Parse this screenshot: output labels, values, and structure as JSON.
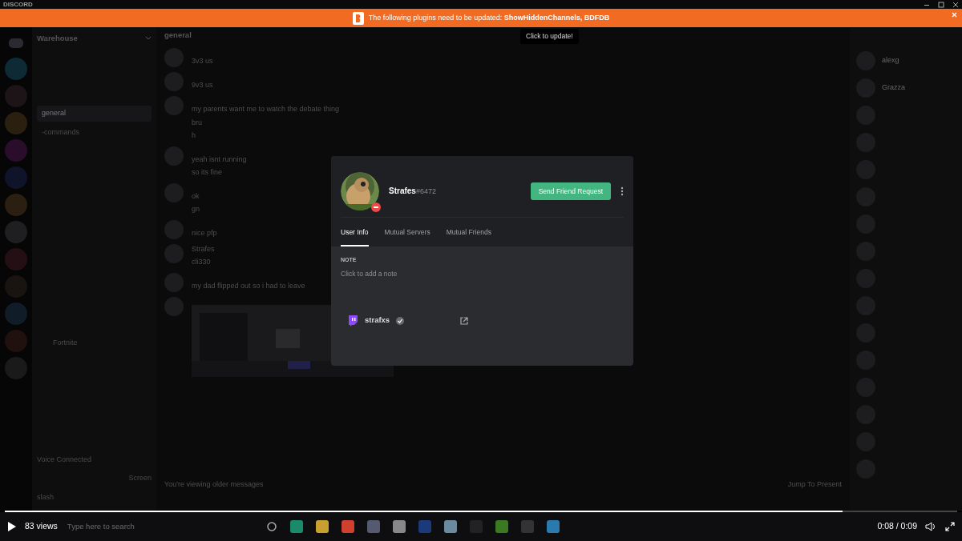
{
  "title_bar": {
    "title": "DISCORD"
  },
  "banner": {
    "message": "The following plugins need to be updated:",
    "plugins": "ShowHiddenChannels, BDFDB",
    "tooltip": "Click to update!"
  },
  "server": {
    "name": "Warehouse"
  },
  "channels": [
    {
      "kind": "text",
      "name": "general",
      "selected": true
    },
    {
      "kind": "text",
      "name": "-commands",
      "selected": false
    },
    {
      "kind": "voice",
      "name": "Fortnite",
      "selected": false
    }
  ],
  "voice_panel": {
    "status": "Voice Connected",
    "screen_button": "Screen"
  },
  "user_panel": {
    "name": "slash"
  },
  "chat": {
    "channel": "general",
    "messages": [
      {
        "lines": [
          "3v3 us"
        ]
      },
      {
        "lines": [
          "9v3 us"
        ]
      },
      {
        "lines": [
          "my parents want me to watch the debate thing",
          "bru",
          "h"
        ]
      },
      {
        "lines": [
          "yeah isnt running",
          "so its fine"
        ]
      },
      {
        "lines": [
          "ok",
          "gn"
        ]
      },
      {
        "lines": [
          "nice pfp"
        ]
      },
      {
        "author": "Strafes",
        "lines": [
          "cli330"
        ]
      },
      {
        "lines": [
          "my dad flipped out so i had to leave"
        ]
      },
      {
        "kind": "picture"
      }
    ],
    "older_notice": "You're viewing older messages",
    "jump_button": "Jump To Present"
  },
  "members": [
    {
      "name": "alexg"
    },
    {
      "name": "Grazza"
    }
  ],
  "profile": {
    "username": "Strafes",
    "discriminator": "#6472",
    "friend_button": "Send Friend Request",
    "tabs": [
      {
        "label": "User Info",
        "selected": true
      },
      {
        "label": "Mutual Servers",
        "selected": false
      },
      {
        "label": "Mutual Friends",
        "selected": false
      }
    ],
    "note_label": "NOTE",
    "note_placeholder": "Click to add a note",
    "connection": {
      "name": "strafxs",
      "verified": true
    }
  },
  "taskbar": {
    "search_placeholder": "Type here to search"
  },
  "video": {
    "views": "83 views",
    "time": "0:08 / 0:09",
    "level": 0.88
  }
}
